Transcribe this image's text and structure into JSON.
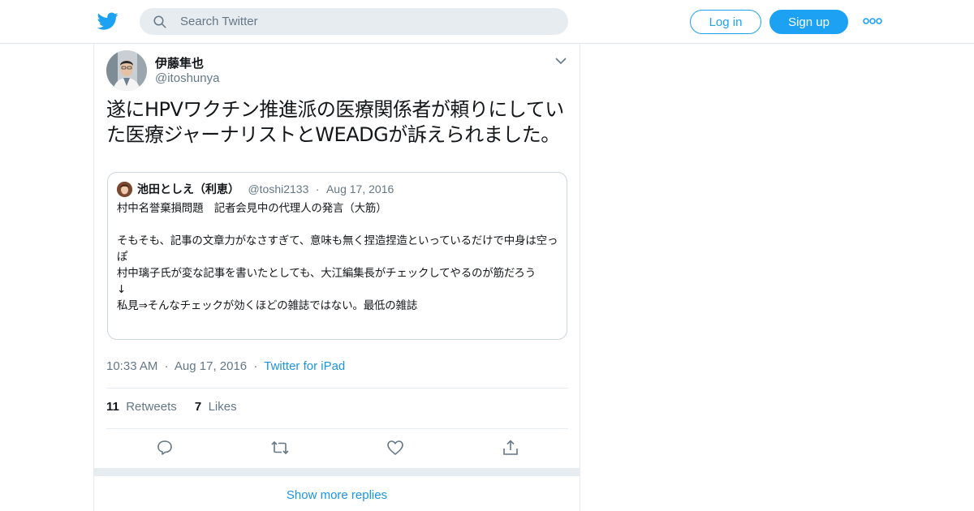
{
  "nav": {
    "search_placeholder": "Search Twitter",
    "login_label": "Log in",
    "signup_label": "Sign up",
    "logo_icon": "twitter-bird-icon",
    "more_icon": "more-dots-icon"
  },
  "colors": {
    "accent": "#1da1f2",
    "link": "#1b95e0",
    "secondary_text": "#657786",
    "border": "#e6ecf0",
    "search_bg": "#e6ecf0"
  },
  "tweet": {
    "display_name": "伊藤隼也",
    "handle": "@itoshunya",
    "text": "遂にHPVワクチン推進派の医療関係者が頼りにしていた医療ジャーナリストとWEADGが訴えられました。",
    "time": "10:33 AM",
    "date": "Aug 17, 2016",
    "separator": "·",
    "source": "Twitter for iPad",
    "retweets_count": "11",
    "retweets_label": "Retweets",
    "likes_count": "7",
    "likes_label": "Likes"
  },
  "quote": {
    "display_name": "池田としえ（利恵）",
    "handle": "@toshi2133",
    "separator": "·",
    "date": "Aug 17, 2016",
    "text": "村中名誉棄損問題　記者会見中の代理人の発言（大筋）\n\nそもそも、記事の文章力がなさすぎて、意味も無く捏造捏造といっているだけで中身は空っぽ\n村中璃子氏が変な記事を書いたとしても、大江編集長がチェックしてやるのが筋だろう\n↓\n私見⇒そんなチェックが効くほどの雑誌ではない。最低の雑誌"
  },
  "actions": [
    "reply-icon",
    "retweet-icon",
    "like-icon",
    "share-icon"
  ],
  "show_more_label": "Show more replies"
}
